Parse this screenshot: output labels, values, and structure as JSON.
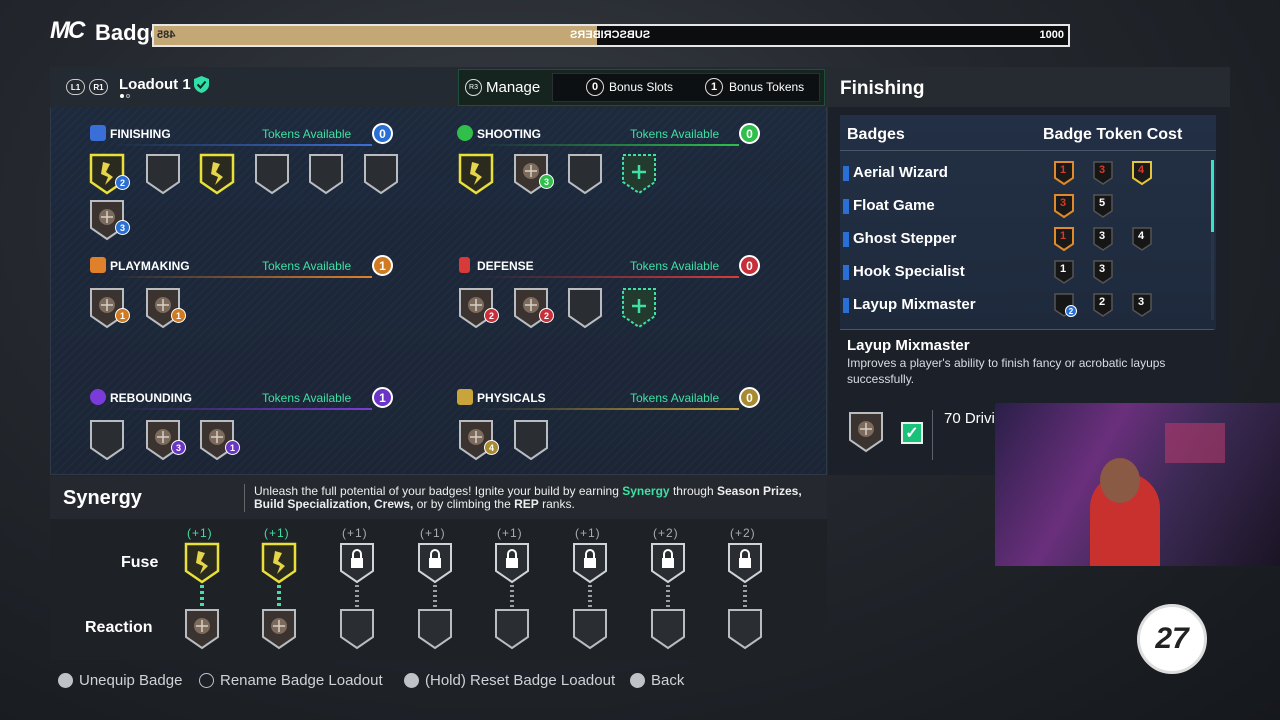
{
  "header": {
    "logo": "MC",
    "title": "Badges",
    "subscribers": {
      "label": "SUBSCRIBERS",
      "current": "485",
      "goal": "1000",
      "progress": 0.485
    }
  },
  "loadout": {
    "name": "Loadout 1",
    "l1": "L1",
    "r1": "R1",
    "manage_label": "Manage",
    "r3": "R3",
    "bonus_slots_value": "0",
    "bonus_slots_label": "Bonus Slots",
    "bonus_tokens_value": "1",
    "bonus_tokens_label": "Bonus Tokens"
  },
  "categories": [
    {
      "name": "FINISHING",
      "tokens_label": "Tokens Available",
      "tokens": "0",
      "color": "#3b6fd8"
    },
    {
      "name": "SHOOTING",
      "tokens_label": "Tokens Available",
      "tokens": "0",
      "color": "#2fbf4a"
    },
    {
      "name": "PLAYMAKING",
      "tokens_label": "Tokens Available",
      "tokens": "1",
      "color": "#e0802a"
    },
    {
      "name": "DEFENSE",
      "tokens_label": "Tokens Available",
      "tokens": "0",
      "color": "#d83a3a"
    },
    {
      "name": "REBOUNDING",
      "tokens_label": "Tokens Available",
      "tokens": "1",
      "color": "#7b3bd8"
    },
    {
      "name": "PHYSICALS",
      "tokens_label": "Tokens Available",
      "tokens": "0",
      "color": "#c8a43a"
    }
  ],
  "badge_numbers": {
    "fin_1": "2",
    "fin_2": "3",
    "sho_1": "3",
    "ply_1": "1",
    "ply_2": "1",
    "def_1": "2",
    "def_2": "2",
    "reb_1": "3",
    "reb_2": "1",
    "phy_1": "4"
  },
  "right_panel": {
    "title": "Finishing",
    "col_badges": "Badges",
    "col_cost": "Badge Token Cost",
    "items": [
      {
        "name": "Aerial Wizard",
        "costs": [
          "1",
          "3",
          "4"
        ]
      },
      {
        "name": "Float Game",
        "costs": [
          "3",
          "5"
        ]
      },
      {
        "name": "Ghost Stepper",
        "costs": [
          "1",
          "3",
          "4"
        ]
      },
      {
        "name": "Hook Specialist",
        "costs": [
          "1",
          "3"
        ]
      },
      {
        "name": "Layup Mixmaster",
        "costs": [
          "",
          "2",
          "3"
        ],
        "first_badge_num": "2"
      }
    ],
    "selected_title": "Layup Mixmaster",
    "selected_desc": "Improves a player's ability to finish fancy or acrobatic layups successfully.",
    "requirement": "70 Drivi"
  },
  "synergy": {
    "title": "Synergy",
    "desc_1": "Unleash the full potential of your badges! Ignite your build by earning ",
    "desc_synergy": "Synergy",
    "desc_2": " through ",
    "desc_season": "Season Prizes, Build Specialization, Crews,",
    "desc_3": " or by climbing the ",
    "desc_rep": "REP",
    "desc_4": " ranks.",
    "fuse_label": "Fuse",
    "reaction_label": "Reaction",
    "plus_values": [
      "(+1)",
      "(+1)",
      "(+1)",
      "(+1)",
      "(+1)",
      "(+1)",
      "(+2)",
      "(+2)"
    ]
  },
  "footer": {
    "unequip": "Unequip Badge",
    "rename": "Rename Badge Loadout",
    "reset": "(Hold) Reset Badge Loadout",
    "back": "Back"
  },
  "brand_badge": "27"
}
